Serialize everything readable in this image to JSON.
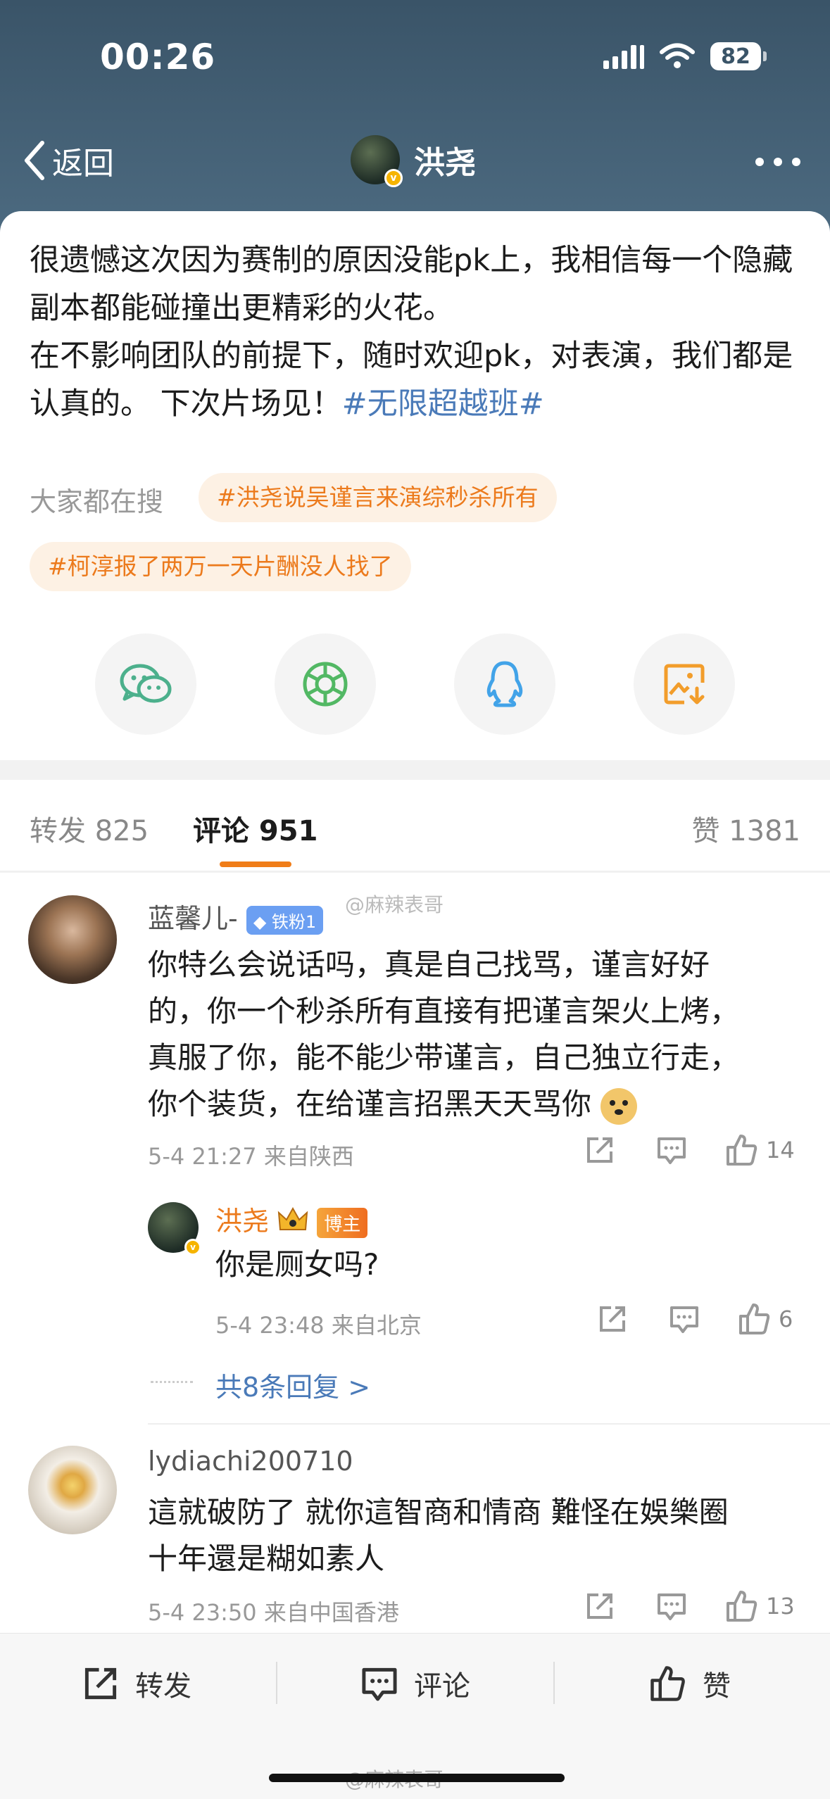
{
  "status_bar": {
    "time": "00:26",
    "battery": "82"
  },
  "nav": {
    "back_label": "返回",
    "title": "洪尧"
  },
  "post": {
    "para1": "很遗憾这次因为赛制的原因没能pk上，我相信每一个隐藏副本都能碰撞出更精彩的火花。",
    "para2": "在不影响团队的前提下，随时欢迎pk，对表演，我们都是认真的。 下次片场见！",
    "hashtag": "#无限超越班#",
    "search_label": "大家都在搜",
    "trending": [
      "#洪尧说吴谨言来演综秒杀所有",
      "#柯淳报了两万一天片酬没人找了"
    ]
  },
  "tabs": {
    "repost": "转发 825",
    "comment": "评论 951",
    "like": "赞 1381"
  },
  "comments": [
    {
      "name": "蓝馨儿-",
      "badge": "铁粉1",
      "text": "你特么会说话吗，真是自己找骂，谨言好好的，你一个秒杀所有直接有把谨言架火上烤，真服了你，能不能少带谨言，自己独立行走，你个装货，在给谨言招黑天天骂你",
      "line1": "你特么会说话吗，真是自己找骂，谨言好好",
      "line2": "的，你一个秒杀所有直接有把谨言架火上烤，",
      "line3": "真服了你，能不能少带谨言，自己独立行走，",
      "line4": "你个装货，在给谨言招黑天天骂你",
      "meta": "5-4 21:27  来自陕西",
      "likes": "14",
      "reply": {
        "name": "洪尧",
        "badge": "博主",
        "text": "你是厕女吗?",
        "meta": "5-4 23:48  来自北京",
        "likes": "6"
      },
      "more_replies": "共8条回复 >"
    },
    {
      "name": "lydiachi200710",
      "line1": "這就破防了 就你這智商和情商 難怪在娛樂圈",
      "line2": "十年還是糊如素人",
      "meta": "5-4 23:50  来自中国香港",
      "likes": "13"
    }
  ],
  "watermark": "@麻辣表哥",
  "bottom_bar": {
    "repost": "转发",
    "comment": "评论",
    "like": "赞"
  },
  "colors": {
    "header": "#3a5468",
    "accent": "#f07d18",
    "link": "#4a7ab8"
  }
}
